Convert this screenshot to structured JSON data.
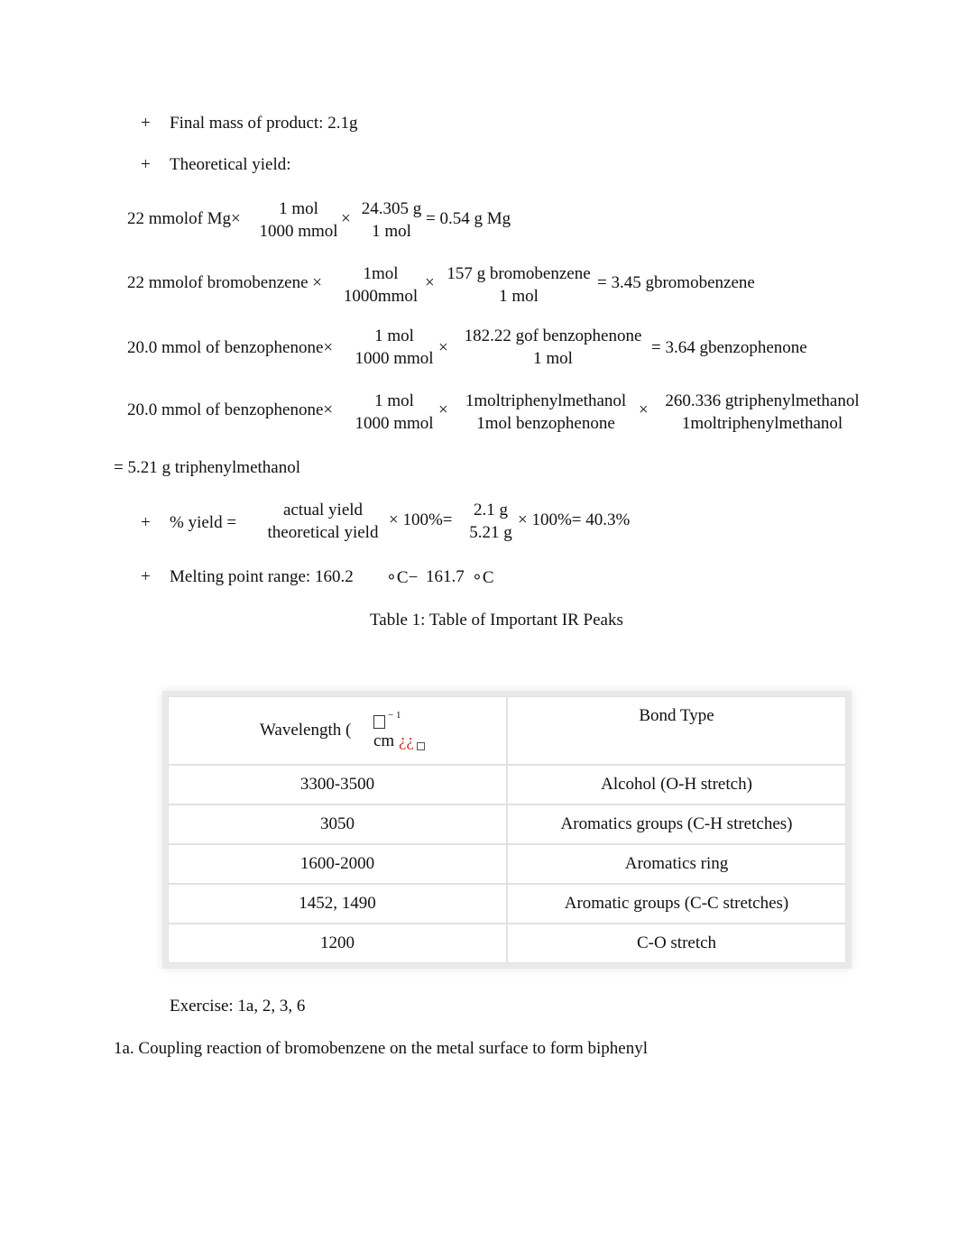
{
  "bullets": {
    "symbol": "+",
    "final_mass": "Final mass of product: 2.1g",
    "theoretical_yield": "Theoretical yield:",
    "melting_point": "Melting point range: 160.2",
    "mp_unit1": "∘C−",
    "mp_value2": "161.7",
    "mp_unit2": "∘C"
  },
  "calc1": {
    "lead": "22 mmolof  Mg×",
    "f1_num": "1 mol",
    "f1_den": "1000 mmol",
    "times": "×",
    "f2_num": "24.305 g",
    "f2_den": "1 mol",
    "result": "= 0.54 g Mg"
  },
  "calc2": {
    "lead": "22 mmolof bromobenzene ×",
    "f1_num": "1mol",
    "f1_den": "1000mmol",
    "times": "×",
    "f2_num": "157 g bromobenzene",
    "f2_den": "1 mol",
    "result": "= 3.45 gbromobenzene"
  },
  "calc3": {
    "lead": "20.0 mmol of benzophenone×",
    "f1_num": "1 mol",
    "f1_den": "1000 mmol",
    "times": "×",
    "f2_num": "182.22 gof benzophenone",
    "f2_den": "1 mol",
    "result": "= 3.64 gbenzophenone"
  },
  "calc4": {
    "lead": "20.0 mmol of benzophenone×",
    "f1_num": "1 mol",
    "f1_den": "1000 mmol",
    "times": "×",
    "f2_num": "1moltriphenylmethanol",
    "f2_den": "1mol benzophenone",
    "times2": "×",
    "f3_num": "260.336 gtriphenylmethanol",
    "f3_den": "1moltriphenylmethanol",
    "result": "= 5.21 g triphenylmethanol"
  },
  "yield": {
    "label": "% yield =",
    "f1_num": "actual yield",
    "f1_den": "theoretical yield",
    "mid": "× 100%=",
    "f2_num": "2.1 g",
    "f2_den": "5.21 g",
    "result": "× 100%= 40.3%"
  },
  "table": {
    "caption": "Table 1: Table of Important IR Peaks",
    "header_col1": "Wavelength (",
    "header_unit": "cm",
    "header_exp": "− 1",
    "header_garble": "¿¿",
    "header_col2": "Bond Type",
    "rows": [
      {
        "wavelength": "3300-3500",
        "bond": "Alcohol (O-H stretch)"
      },
      {
        "wavelength": "3050",
        "bond": "Aromatics groups (C-H stretches)"
      },
      {
        "wavelength": "1600-2000",
        "bond": "Aromatics ring"
      },
      {
        "wavelength": "1452, 1490",
        "bond": "Aromatic groups (C-C stretches)"
      },
      {
        "wavelength": "1200",
        "bond": "C-O stretch"
      }
    ]
  },
  "exercise": "Exercise: 1a, 2, 3, 6",
  "answer_1a": "1a. Coupling reaction of bromobenzene on the metal surface to form biphenyl"
}
